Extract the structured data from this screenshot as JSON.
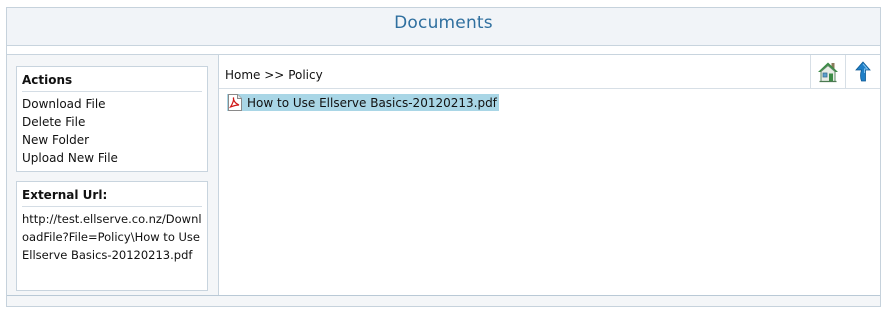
{
  "header": {
    "title": "Documents"
  },
  "actions": {
    "heading": "Actions",
    "items": [
      {
        "label": "Download File"
      },
      {
        "label": "Delete File"
      },
      {
        "label": "New Folder"
      },
      {
        "label": "Upload New File"
      }
    ]
  },
  "external_url": {
    "heading": "External Url:",
    "value": "http://test.ellserve.co.nz/DownloadFile?File=Policy\\How to Use Ellserve Basics-20120213.pdf"
  },
  "breadcrumb": {
    "home": "Home",
    "separator": " >> ",
    "current": "Policy"
  },
  "toolbar": {
    "home_icon": "home-icon",
    "up_icon": "up-arrow-icon"
  },
  "files": [
    {
      "name": "How to Use Ellserve Basics-20120213.pdf",
      "icon": "pdf-file-icon",
      "selected": true
    }
  ],
  "colors": {
    "title": "#2f6f9f",
    "selection": "#a9d6e6",
    "border": "#c8d4de"
  }
}
